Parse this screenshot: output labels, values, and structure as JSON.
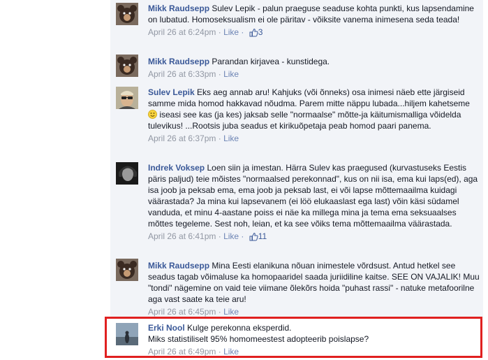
{
  "comments": [
    {
      "name": "Mikk Raudsepp",
      "text": "Sulev Lepik - palun praeguse seaduse kohta punkti, kus lapsendamine on lubatud. Homoseksualism ei ole päritav - võiksite vanema inimesena seda teada!",
      "time": "April 26 at 6:24pm",
      "like_label": "Like",
      "like_count": "3",
      "avatar_icon": "teddy-bear-avatar"
    },
    {
      "name": "Mikk Raudsepp",
      "text": "Parandan kirjavea - kunstidega.",
      "time": "April 26 at 6:33pm",
      "like_label": "Like",
      "like_count": "",
      "avatar_icon": "teddy-bear-avatar"
    },
    {
      "name": "Sulev Lepik",
      "text_before": "Eks aeg annab aru! Kahjuks (või õnneks) osa inimesi näeb ette järgiseid samme mida homod hakkavad nõudma. Parem mitte näppu lubada...hiljem kahetseme",
      "text_after": "iseasi see kas (ja kes) jaksab selle \"normaalse\" mõtte-ja käitumismalliga võidelda tulevikus! ...Rootsis juba seadus et kirikuõpetaja peab homod paari panema.",
      "time": "April 26 at 6:37pm",
      "like_label": "Like",
      "like_count": "",
      "avatar_icon": "man-sunglasses-avatar"
    },
    {
      "name": "Indrek Voksep",
      "text": "Loen siin ja imestan. Härra Sulev kas praegused (kurvastuseks Eestis päris paljud) teie mõistes \"normaalsed perekonnad\", kus on nii isa, ema kui laps(ed), aga isa joob ja peksab ema, ema joob ja peksab last, ei või lapse mõttemaailma kuidagi väärastada? Ja mina kui lapsevanem (ei löö elukaaslast ega last) võin käsi südamel vanduda, et minu 4-aastane poiss ei näe ka millega mina ja tema ema seksuaalses mõttes tegeleme. Sest noh, leian, et ka see võiks tema mõttemaailma väärastada.",
      "time": "April 26 at 6:41pm",
      "like_label": "Like",
      "like_count": "11",
      "avatar_icon": "headphones-man-avatar"
    },
    {
      "name": "Mikk Raudsepp",
      "text": "Mina Eesti elanikuna nõuan inimestele võrdsust. Antud hetkel see seadus tagab võimaluse ka homopaaridel saada juriidiline kaitse. SEE ON VAJALIK! Muu \"tondi\" nägemine on vaid teie viimane õlekõrs hoida \"puhast rassi\" - natuke metafoorilne aga vast saate ka teie aru!",
      "time": "April 26 at 6:45pm",
      "like_label": "Like",
      "like_count": "",
      "avatar_icon": "teddy-bear-avatar"
    },
    {
      "name": "Erki Nool",
      "text_line1": "Kulge perekonna eksperdid.",
      "text_line2": "Miks statistiliselt 95% homomeestest adopteerib poislapse?",
      "time": "April 26 at 6:49pm",
      "like_label": "Like",
      "like_count": "",
      "avatar_icon": "silhouette-sunset-avatar"
    }
  ],
  "separator": " · ",
  "colors": {
    "name": "#3b5998",
    "highlight_border": "#e02020",
    "comment_bg": "#f2f4f8"
  }
}
